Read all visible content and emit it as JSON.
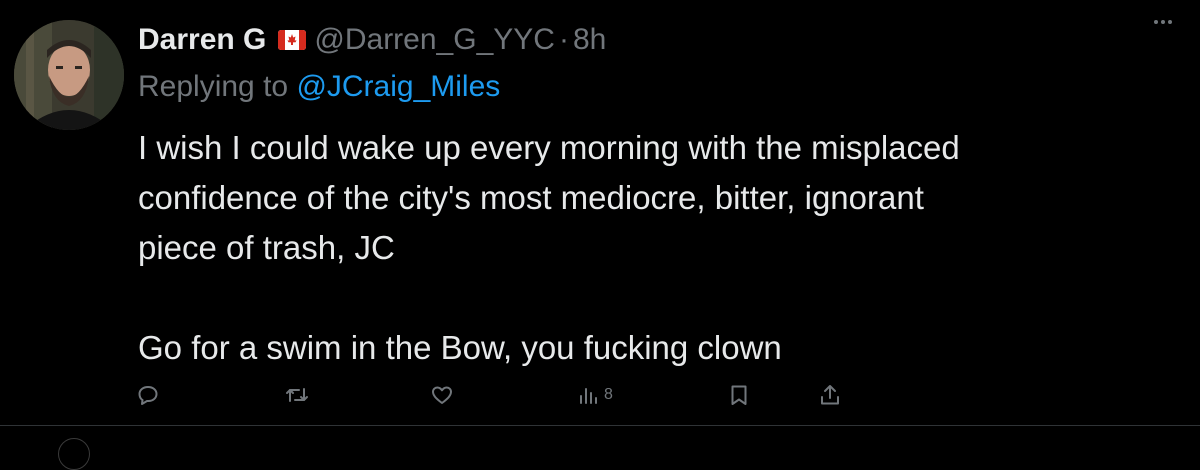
{
  "tweet": {
    "author": {
      "display_name": "Darren G",
      "flag": "canada-flag",
      "handle": "@Darren_G_YYC",
      "separator": "·",
      "time": "8h"
    },
    "reply": {
      "prefix": "Replying to",
      "handle": "@JCraig_Miles"
    },
    "text": {
      "line1": "I wish I could wake up every morning with the misplaced",
      "line2": "confidence of the city's most mediocre, bitter, ignorant",
      "line3": "piece of trash, JC",
      "line4": "Go for a swim in the Bow, you fucking clown"
    },
    "actions": {
      "reply_icon": "reply-icon",
      "retweet_icon": "retweet-icon",
      "like_icon": "like-icon",
      "views_icon": "views-icon",
      "views_count": "8",
      "bookmark_icon": "bookmark-icon",
      "share_icon": "share-icon"
    },
    "more_icon": "more-icon"
  },
  "colors": {
    "background": "#000000",
    "text": "#e7e9ea",
    "muted": "#71767b",
    "link": "#1d9bf0",
    "divider": "#2f3336"
  }
}
